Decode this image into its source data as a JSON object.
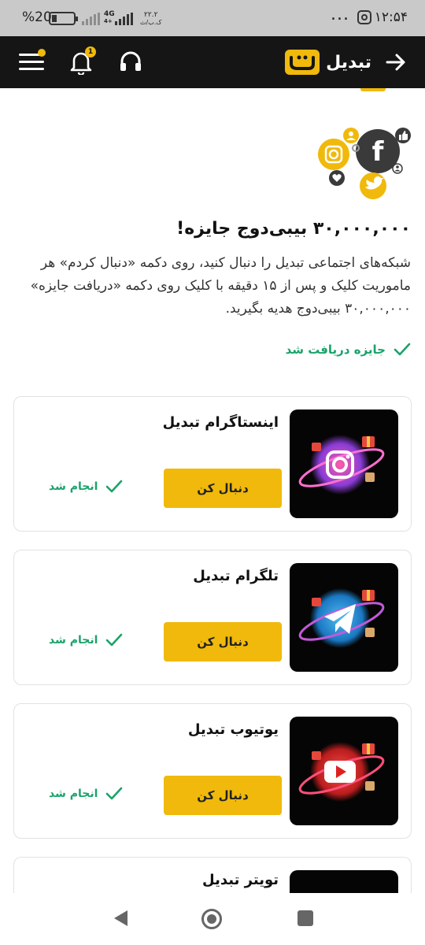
{
  "status_bar": {
    "time": "۱۲:۵۴",
    "battery_percent": "%20",
    "network": "4G",
    "network_sub": "4+",
    "speed_value": "۲۲.۲",
    "speed_unit": "ک.ب/ث",
    "more_dots": "..."
  },
  "header": {
    "app_name": "تبدیل",
    "notification_count": "1",
    "colors": {
      "background": "#151515",
      "accent": "#f0b90b"
    }
  },
  "main": {
    "reward_title": "۳۰,۰۰۰,۰۰۰ بیبی‌دوج جایزه!",
    "description": "شبکه‌های اجتماعی تبدیل را دنبال کنید، روی دکمه «دنبال کردم» هر ماموریت کلیک و پس از ۱۵ دقیقه با کلیک روی دکمه «دریافت جایزه» ۳۰,۰۰۰,۰۰۰ بیبی‌دوج هدیه بگیرید.",
    "reward_status": "جایزه دریافت شد"
  },
  "tasks": [
    {
      "title": "اینستاگرام تبدیل",
      "button": "دنبال کن",
      "status": "انجام شد",
      "icon": "instagram-icon"
    },
    {
      "title": "تلگرام تبدیل",
      "button": "دنبال کن",
      "status": "انجام شد",
      "icon": "telegram-icon"
    },
    {
      "title": "یوتیوب تبدیل",
      "button": "دنبال کن",
      "status": "انجام شد",
      "icon": "youtube-icon"
    },
    {
      "title": "تویتر تبدیل",
      "icon": "twitter-icon"
    }
  ],
  "colors": {
    "success": "#1aa36a",
    "button": "#f0b90b"
  }
}
